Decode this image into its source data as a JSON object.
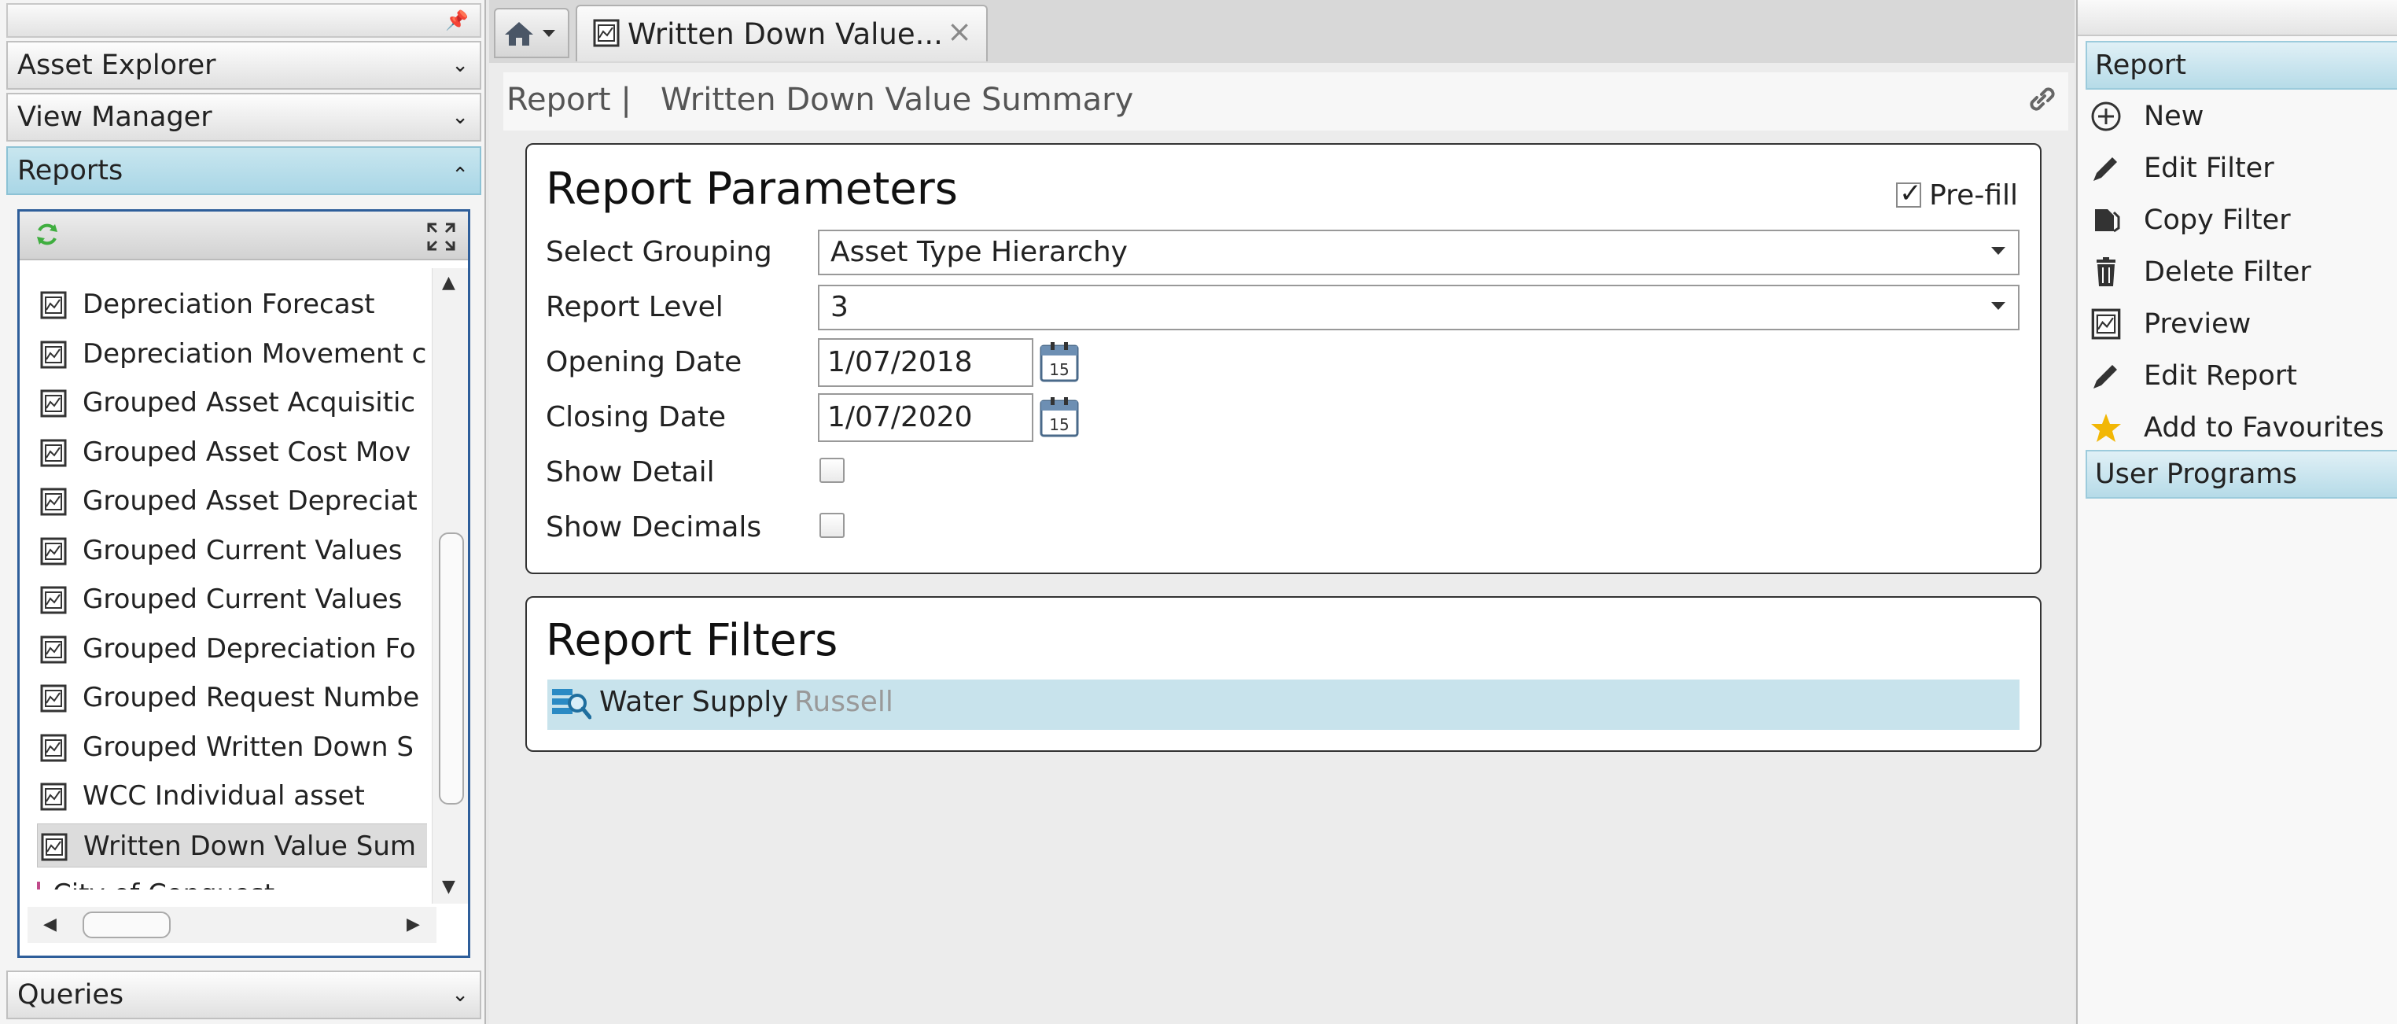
{
  "left_panel": {
    "accordion": {
      "asset_explorer": "Asset Explorer",
      "view_manager": "View Manager",
      "reports": "Reports",
      "queries": "Queries"
    },
    "tree_items": [
      "Depreciation Forecast",
      "Depreciation Movement c",
      "Grouped Asset Acquisitic",
      "Grouped Asset Cost Mov",
      "Grouped Asset Depreciat",
      "Grouped Current Values",
      "Grouped Current Values",
      "Grouped Depreciation Fo",
      "Grouped Request Numbe",
      "Grouped Written Down S",
      "WCC Individual asset",
      "Written Down Value Sum"
    ],
    "tree_partial_item": "City of Conquest",
    "selected_item_index": 11
  },
  "tabs": {
    "report_tab_label": "Written Down Value...",
    "close_glyph": "×"
  },
  "title_bar": {
    "section": "Report |",
    "page_title": "Written Down Value Summary"
  },
  "params": {
    "title": "Report Parameters",
    "prefill_label": "Pre-fill",
    "prefill_checked": true,
    "select_grouping_label": "Select Grouping",
    "select_grouping_value": "Asset Type Hierarchy",
    "report_level_label": "Report Level",
    "report_level_value": "3",
    "opening_date_label": "Opening Date",
    "opening_date_value": "1/07/2018",
    "closing_date_label": "Closing Date",
    "closing_date_value": "1/07/2020",
    "show_detail_label": "Show Detail",
    "show_detail_checked": false,
    "show_decimals_label": "Show Decimals",
    "show_decimals_checked": false,
    "calendar_day": "15"
  },
  "filters": {
    "title": "Report Filters",
    "items": [
      {
        "name": "Water Supply",
        "user": "Russell"
      }
    ]
  },
  "right_panel": {
    "report_header": "Report",
    "actions": [
      "New",
      "Edit Filter",
      "Copy Filter",
      "Delete Filter",
      "Preview",
      "Edit Report",
      "Add to Favourites"
    ],
    "user_programs_header": "User Programs"
  },
  "colors": {
    "accent_blue": "#2e5e9a",
    "selected_section": "#a9d6e6",
    "filter_row": "#c8e3ec",
    "favourite_star": "#f2b705"
  }
}
